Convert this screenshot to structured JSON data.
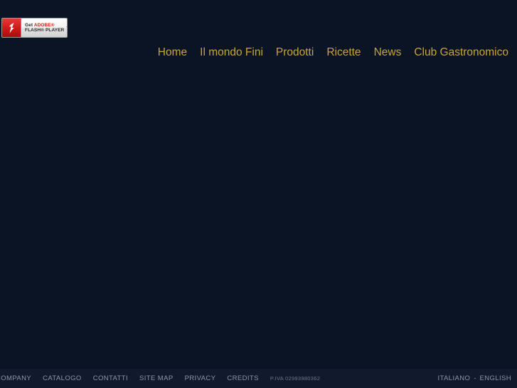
{
  "site": {
    "background_color": "#0a1424",
    "accent_color": "#c9a43a",
    "footer_text_color": "#8e96a6"
  },
  "flash_badge": {
    "icon": "flash-player-logo-icon",
    "download_icon": "download-arrow-icon",
    "line1_prefix": "Get ",
    "line1_brand": "ADOBE®",
    "line2": "FLASH® PLAYER"
  },
  "nav": {
    "items": [
      {
        "label": "Home"
      },
      {
        "label": "Il mondo Fini"
      },
      {
        "label": "Prodotti"
      },
      {
        "label": "Ricette"
      },
      {
        "label": "News"
      },
      {
        "label": "Club Gastronomico"
      }
    ]
  },
  "footer": {
    "links": [
      {
        "label": "COMPANY"
      },
      {
        "label": "CATALOGO"
      },
      {
        "label": "CONTATTI"
      },
      {
        "label": "SITE MAP"
      },
      {
        "label": "PRIVACY"
      },
      {
        "label": "CREDITS"
      }
    ],
    "vat": "P.IVA 02993980362",
    "languages": {
      "italian": "ITALIANO",
      "separator": "-",
      "english": "ENGLISH"
    }
  }
}
